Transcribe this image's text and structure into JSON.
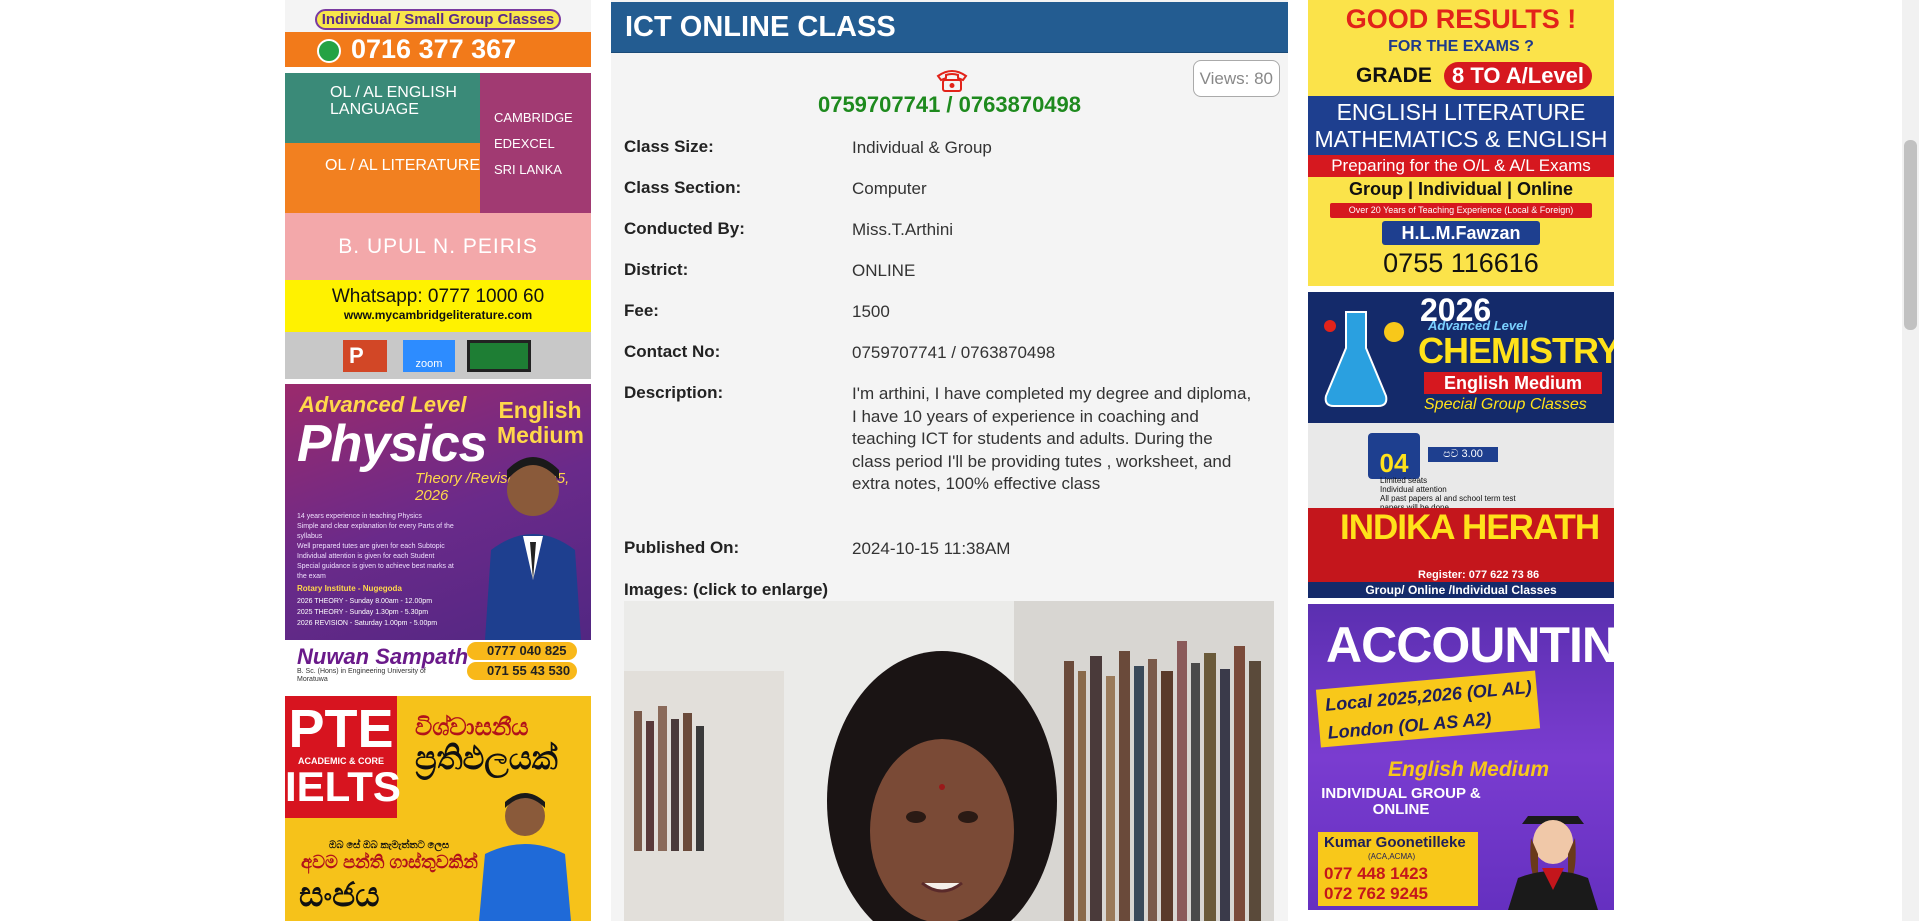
{
  "listing": {
    "title": "ICT ONLINE CLASS",
    "views": "Views: 80",
    "phones": "0759707741 / 0763870498",
    "fields": [
      {
        "label": "Class Size:",
        "value": "Individual & Group"
      },
      {
        "label": "Class Section:",
        "value": "Computer"
      },
      {
        "label": "Conducted By:",
        "value": "Miss.T.Arthini"
      },
      {
        "label": "District:",
        "value": "ONLINE"
      },
      {
        "label": "Fee:",
        "value": "1500"
      },
      {
        "label": "Contact No:",
        "value": "0759707741 / 0763870498"
      },
      {
        "label": "Description:",
        "value": "I'm arthini, I have completed my degree and diploma, I have 10 years of experience in coaching and teaching ICT for students and adults. During the class period I'll be providing tutes , worksheet, and extra notes, 100% effective class"
      },
      {
        "label": "Published On:",
        "value": "2024-10-15 11:38AM"
      }
    ],
    "images_label": "Images: (click to enlarge)"
  },
  "left_ads": {
    "ad1": {
      "tagline": "Individual / Small Group Classes",
      "phone": "0716 377 367"
    },
    "ad2": {
      "teal_text": "OL / AL ENGLISH LANGUAGE",
      "orange_text": "OL / AL LITERATURE",
      "boards": [
        "CAMBRIDGE",
        "EDEXCEL",
        "SRI LANKA"
      ],
      "teacher": "B. UPUL N. PEIRIS",
      "whatsapp": "Whatsapp: 0777 1000 60",
      "url": "www.mycambridgeliterature.com",
      "zoom": "zoom"
    },
    "ad3": {
      "level": "Advanced Level",
      "subject": "Physics",
      "theory": "Theory /Revision 2025, 2026",
      "medium": "English Medium",
      "bullets": [
        "14 years experience in teaching Physics",
        "Simple and clear explanation for every Parts of the syllabus",
        "Well prepared tutes are given for each Subtopic",
        "Individual attention is given for each Student",
        "Special guidance is given to achieve best marks at the exam"
      ],
      "institute": "Rotary Institute - Nugegoda",
      "schedule": [
        "2026 THEORY - Sunday 8.00am - 12.00pm",
        "2025 THEORY - Sunday 1.30pm - 5.30pm",
        "2026 REVISION - Saturday 1.00pm - 5.00pm"
      ],
      "name": "Nuwan Sampath",
      "degree": "B. Sc. (Hons) in Engineering University of Moratuwa",
      "phone1": "0777 040 825",
      "phone2": "071 55 43 530"
    },
    "ad4": {
      "pte": "PTE",
      "academic": "ACADEMIC & CORE",
      "ielts": "IELTS",
      "si1": "විශ්වාසනීය",
      "si2": "ප්‍රතිඵලයක්",
      "si3": "ඔබ සේ ඔබ කැමැත්තට ලෙස",
      "si4": "අවම පන්ති ගාස්තුවකින්",
      "si5": "සංජය"
    }
  },
  "right_ads": {
    "ad1": {
      "headline": "GOOD RESULTS !",
      "exams": "FOR THE EXAMS ?",
      "grade": "GRADE",
      "grade_range": "8 TO A/Level",
      "subjects": [
        "ENGLISH LITERATURE",
        "MATHEMATICS & ENGLISH"
      ],
      "prep": "Preparing for the O/L & A/L Exams",
      "modes": "Group | Individual | Online",
      "experience": "Over 20 Years of Teaching Experience (Local & Foreign)",
      "name": "H.L.M.Fawzan",
      "phone": "0755 116616"
    },
    "ad2": {
      "year": "2026",
      "level": "Advanced Level",
      "subject": "CHEMISTRY",
      "medium": "English Medium",
      "special": "Special Group Classes",
      "date": "04",
      "time": "පව 3.00",
      "notes": [
        "Limited seats",
        "Individual attention",
        "All past papers al and school term test papers will be done"
      ],
      "teacher": "INDIKA HERATH",
      "register": "Register: 077 622 73 86",
      "group": "Group/ Online /Individual Classes"
    },
    "ad3": {
      "title": "ACCOUNTING",
      "local": "Local 2025,2026 (OL AL)",
      "london": "London (OL AS A2)",
      "medium": "English Medium",
      "modes": "INDIVIDUAL GROUP & ONLINE",
      "name": "Kumar Goonetilleke",
      "quals": "(ACA,ACMA)",
      "phone1": "077 448 1423",
      "phone2": "072 762 9245"
    }
  }
}
